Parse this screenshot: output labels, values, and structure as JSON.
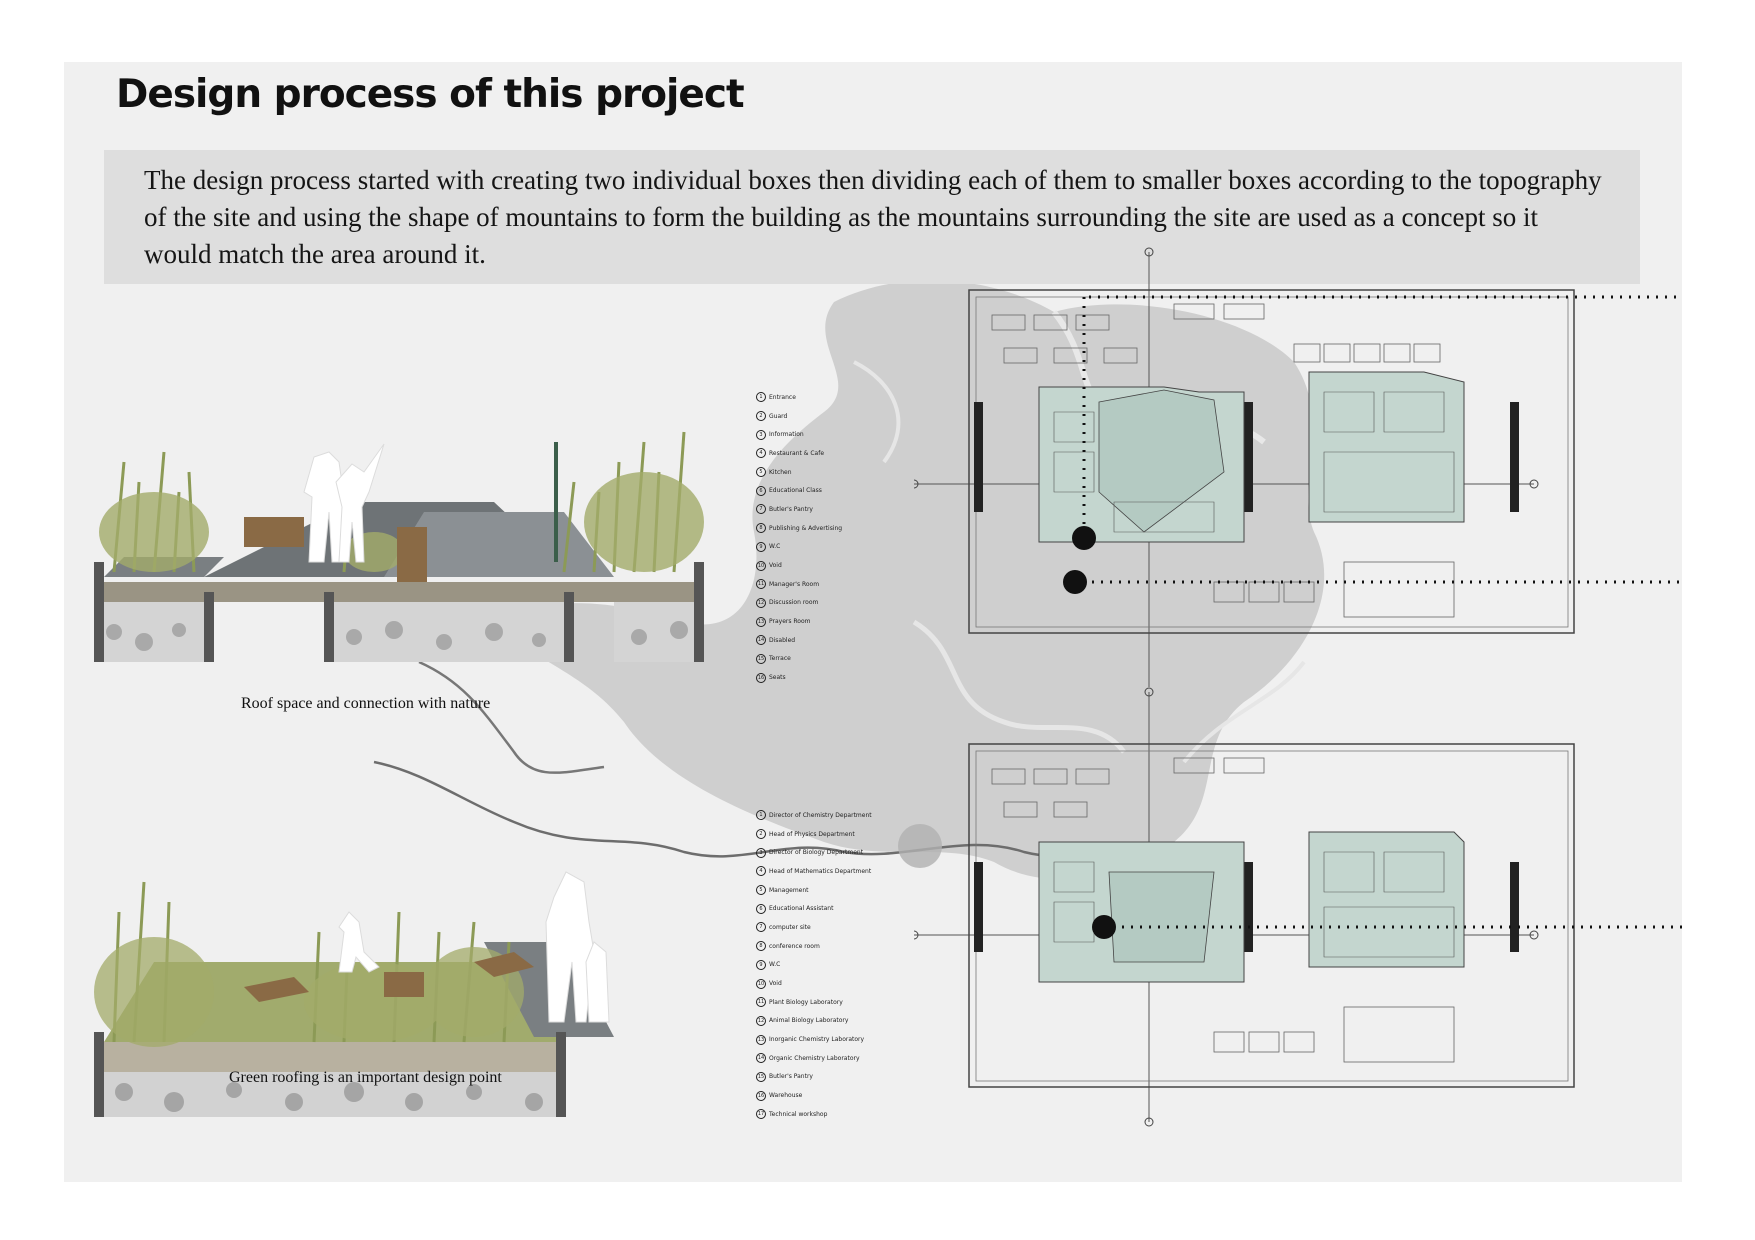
{
  "header": {
    "title": "Design process of this project",
    "intro": "The design process started with creating two individual boxes then dividing each of them to smaller boxes according to the topography of the site and using the shape of mountains to form the building as the mountains surrounding the site are used as a concept so it would match the area around it."
  },
  "sections": {
    "top_caption": "Roof space and connection with nature",
    "bottom_caption": "Green roofing is an important design point"
  },
  "legend_top": [
    {
      "num": "1",
      "label": "Entrance"
    },
    {
      "num": "2",
      "label": "Guard"
    },
    {
      "num": "3",
      "label": "Information"
    },
    {
      "num": "4",
      "label": "Restaurant & Cafe"
    },
    {
      "num": "5",
      "label": "Kitchen"
    },
    {
      "num": "6",
      "label": "Educational Class"
    },
    {
      "num": "7",
      "label": "Butler's Pantry"
    },
    {
      "num": "8",
      "label": "Publishing & Advertising"
    },
    {
      "num": "9",
      "label": "W.C"
    },
    {
      "num": "10",
      "label": "Void"
    },
    {
      "num": "11",
      "label": "Manager's Room"
    },
    {
      "num": "12",
      "label": "Discussion room"
    },
    {
      "num": "13",
      "label": "Prayers Room"
    },
    {
      "num": "14",
      "label": "Disabled"
    },
    {
      "num": "15",
      "label": "Terrace"
    },
    {
      "num": "16",
      "label": "Seats"
    }
  ],
  "legend_bottom": [
    {
      "num": "1",
      "label": "Director of Chemistry Department"
    },
    {
      "num": "2",
      "label": "Head of Physics Department"
    },
    {
      "num": "3",
      "label": "Director of Biology Department"
    },
    {
      "num": "4",
      "label": "Head of Mathematics Department"
    },
    {
      "num": "5",
      "label": "Management"
    },
    {
      "num": "6",
      "label": "Educational Assistant"
    },
    {
      "num": "7",
      "label": "computer site"
    },
    {
      "num": "8",
      "label": "conference room"
    },
    {
      "num": "9",
      "label": "W.C"
    },
    {
      "num": "10",
      "label": "Void"
    },
    {
      "num": "11",
      "label": "Plant Biology Laboratory"
    },
    {
      "num": "12",
      "label": "Animal Biology Laboratory"
    },
    {
      "num": "13",
      "label": "Inorganic Chemistry Laboratory"
    },
    {
      "num": "14",
      "label": "Organic Chemistry Laboratory"
    },
    {
      "num": "15",
      "label": "Butler's Pantry"
    },
    {
      "num": "16",
      "label": "Warehouse"
    },
    {
      "num": "17",
      "label": "Technical workshop"
    }
  ],
  "colors": {
    "sheet": "#f0f0f0",
    "intro_box": "#dedede",
    "map": "#c8c8c8",
    "building_fill": "#c4d6cf",
    "vegetation": "#8c9a56",
    "deck": "#6e7376"
  }
}
